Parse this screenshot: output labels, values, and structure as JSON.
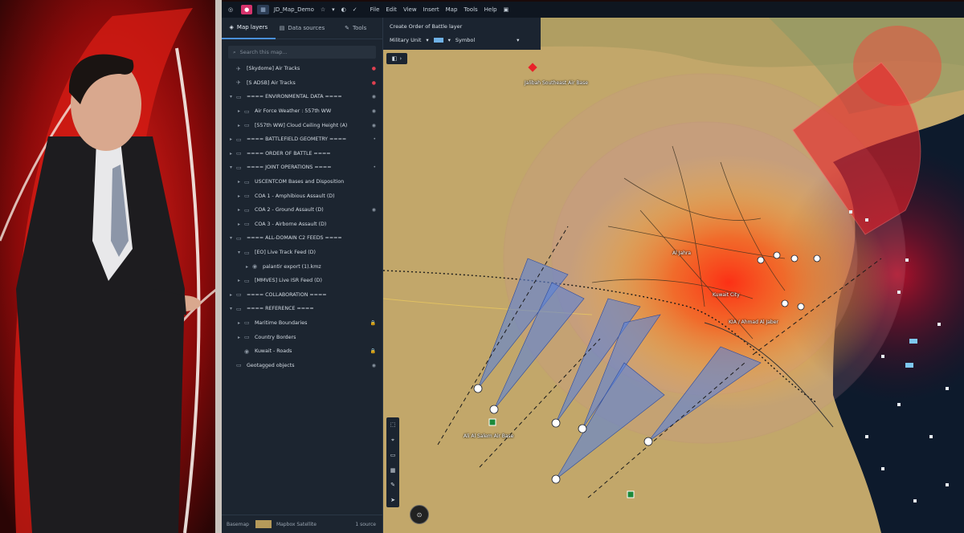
{
  "app": {
    "document_title": "JD_Map_Demo",
    "menu": [
      "File",
      "Edit",
      "View",
      "Insert",
      "Map",
      "Tools",
      "Help"
    ]
  },
  "sidebar": {
    "tabs": [
      "Map layers",
      "Data sources",
      "Tools"
    ],
    "search_placeholder": "Search this map...",
    "layers": [
      {
        "label": "[Skydome] Air Tracks",
        "indent": 0,
        "chev": "",
        "icon": "track-icon",
        "right": "red"
      },
      {
        "label": "[S ADSB] Air Tracks",
        "indent": 0,
        "chev": "",
        "icon": "track-icon",
        "right": "red"
      },
      {
        "label": "==== ENVIRONMENTAL DATA ====",
        "indent": 0,
        "chev": "▾",
        "icon": "folder-icon",
        "right": "eye"
      },
      {
        "label": "Air Force Weather : 557th WW",
        "indent": 1,
        "chev": "▸",
        "icon": "folder-icon",
        "right": "eye"
      },
      {
        "label": "[557th WW] Cloud Ceiling Height (A)",
        "indent": 1,
        "chev": "▸",
        "icon": "folder-icon",
        "right": "eye"
      },
      {
        "label": "==== BATTLEFIELD GEOMETRY ====",
        "indent": 0,
        "chev": "▸",
        "icon": "folder-icon",
        "right": "dot"
      },
      {
        "label": "==== ORDER OF BATTLE ====",
        "indent": 0,
        "chev": "▸",
        "icon": "folder-icon",
        "right": ""
      },
      {
        "label": "==== JOINT OPERATIONS ====",
        "indent": 0,
        "chev": "▾",
        "icon": "folder-icon",
        "right": "dot"
      },
      {
        "label": "USCENTCOM Bases and Disposition",
        "indent": 1,
        "chev": "▸",
        "icon": "folder-icon",
        "right": ""
      },
      {
        "label": "COA 1 - Amphibious Assault (D)",
        "indent": 1,
        "chev": "▸",
        "icon": "folder-icon",
        "right": ""
      },
      {
        "label": "COA 2 - Ground Assault (D)",
        "indent": 1,
        "chev": "▸",
        "icon": "folder-icon",
        "right": "eye"
      },
      {
        "label": "COA 3 - Airborne Assault (D)",
        "indent": 1,
        "chev": "▸",
        "icon": "folder-icon",
        "right": ""
      },
      {
        "label": "==== ALL-DOMAIN C2 FEEDS ====",
        "indent": 0,
        "chev": "▾",
        "icon": "folder-icon",
        "right": ""
      },
      {
        "label": "[EO] Live Track Feed (D)",
        "indent": 1,
        "chev": "▾",
        "icon": "folder-icon",
        "right": ""
      },
      {
        "label": "palantir export (1).kmz",
        "indent": 2,
        "chev": "▸",
        "icon": "eye-icon",
        "right": ""
      },
      {
        "label": "[MMVES] Live ISR Feed (D)",
        "indent": 1,
        "chev": "▸",
        "icon": "folder-icon",
        "right": ""
      },
      {
        "label": "==== COLLABORATION ====",
        "indent": 0,
        "chev": "▸",
        "icon": "folder-icon",
        "right": ""
      },
      {
        "label": "==== REFERENCE ====",
        "indent": 0,
        "chev": "▾",
        "icon": "folder-icon",
        "right": ""
      },
      {
        "label": "Maritime Boundaries",
        "indent": 1,
        "chev": "▸",
        "icon": "folder-icon",
        "right": "lock"
      },
      {
        "label": "Country Borders",
        "indent": 1,
        "chev": "▸",
        "icon": "folder-icon",
        "right": ""
      },
      {
        "label": "Kuwait - Roads",
        "indent": 1,
        "chev": "",
        "icon": "eye-icon",
        "right": "lock"
      },
      {
        "label": "Geotagged objects",
        "indent": 0,
        "chev": "",
        "icon": "folder-icon",
        "right": "eye"
      }
    ],
    "footer": {
      "basemap_label": "Basemap",
      "basemap_name": "Mapbox Satellite",
      "right": "1 source"
    }
  },
  "obat": {
    "title": "Create Order of Battle layer",
    "unit_label": "Military Unit",
    "symbol_label": "Symbol"
  },
  "map_labels": [
    {
      "text": "Jalibah Southeast Air Base",
      "name": "label-jalibah-air-base"
    },
    {
      "text": "Kuwait City",
      "name": "label-kuwait-city"
    },
    {
      "text": "Al Jahra",
      "name": "label-al-jahra"
    },
    {
      "text": "Ali Al Salem Air Base",
      "name": "label-ali-al-salem-air-base"
    },
    {
      "text": "KIA / Ahmad Al Jaber",
      "name": "label-kia"
    }
  ],
  "colors": {
    "accent": "#4a90d9",
    "threat_red": "#e8222a",
    "sensor_blue": "#5a82d8",
    "sea": "#0d1a2c",
    "desert": "#c2a76a"
  }
}
